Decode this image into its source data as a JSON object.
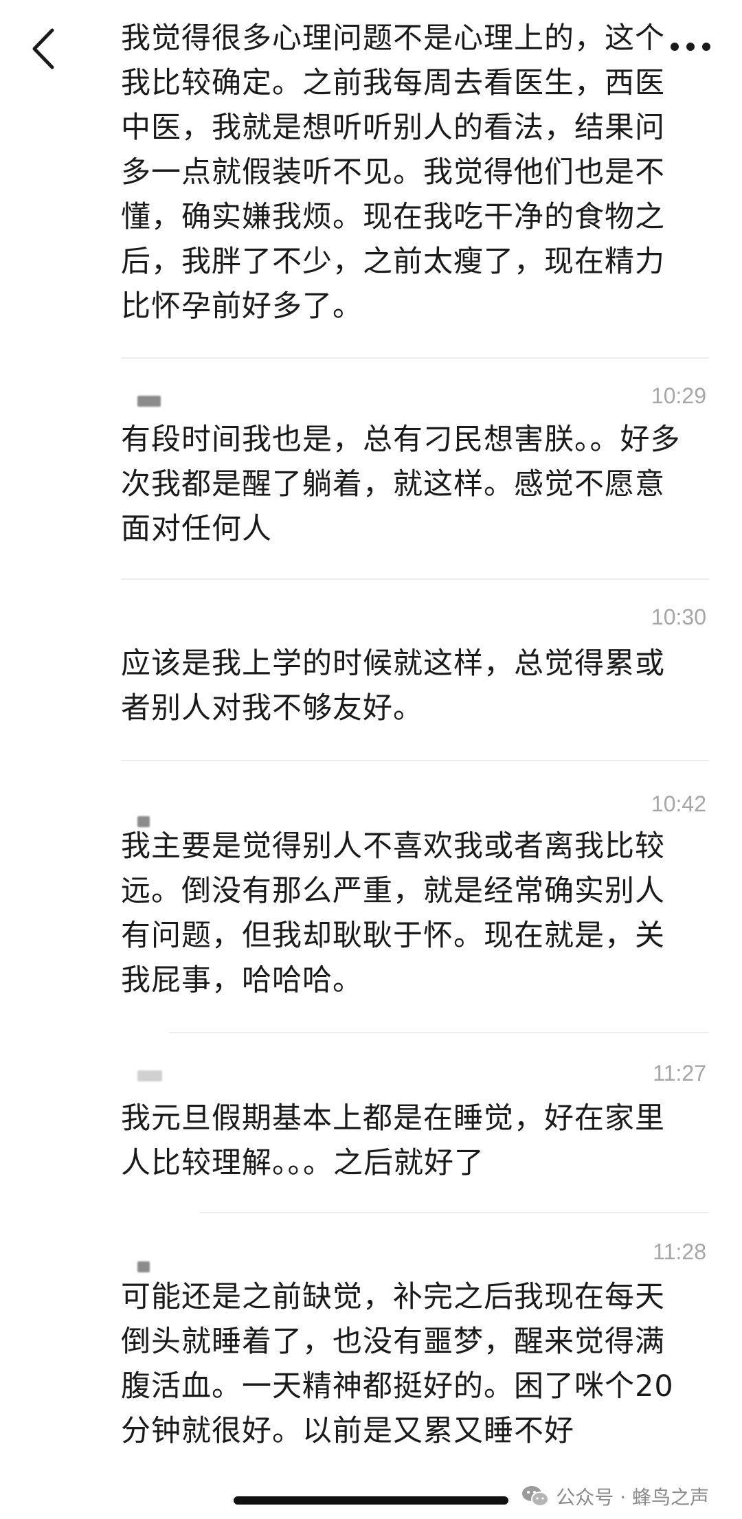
{
  "header": {
    "back_icon": "chevron-left-icon",
    "more_icon": "more-dots-icon"
  },
  "comments": [
    {
      "time": "",
      "text": "我觉得很多心理问题不是心理上的，这个我比较确定。之前我每周去看医生，西医中医，我就是想听听别人的看法，结果问多一点就假装听不见。我觉得他们也是不懂，确实嫌我烦。现在我吃干净的食物之后，我胖了不少，之前太瘦了，现在精力比怀孕前好多了。"
    },
    {
      "time": "10:29",
      "text": "有段时间我也是，总有刁民想害朕。。好多次我都是醒了躺着，就这样。感觉不愿意面对任何人"
    },
    {
      "time": "10:30",
      "text": "应该是我上学的时候就这样，总觉得累或者别人对我不够友好。"
    },
    {
      "time": "10:42",
      "text": "我主要是觉得别人不喜欢我或者离我比较远。倒没有那么严重，就是经常确实别人有问题，但我却耿耿于怀。现在就是，关我屁事，哈哈哈。"
    },
    {
      "time": "11:27",
      "text": "我元旦假期基本上都是在睡觉，好在家里人比较理解。。。之后就好了"
    },
    {
      "time": "11:28",
      "text": "可能还是之前缺觉，补完之后我现在每天倒头就睡着了，也没有噩梦，醒来觉得满腹活血。一天精神都挺好的。困了咪个20分钟就很好。以前是又累又睡不好"
    }
  ],
  "watermark": {
    "icon": "wechat-icon",
    "text": "公众号 · 蜂鸟之声"
  }
}
